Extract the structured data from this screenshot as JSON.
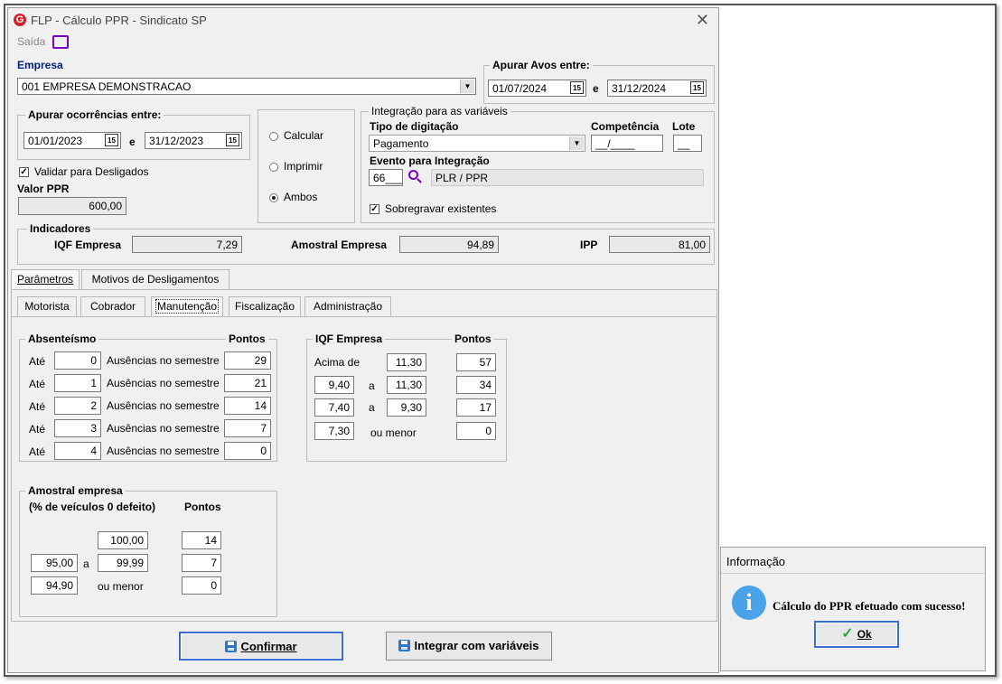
{
  "window": {
    "title": "FLP - Cálculo PPR - Sindicato SP",
    "close_glyph": "✕"
  },
  "menu": {
    "saida": "Saída"
  },
  "empresa": {
    "label": "Empresa",
    "value": "001 EMPRESA DEMONSTRACAO"
  },
  "apurar_avos": {
    "label": "Apurar Avos entre:",
    "from": "01/07/2024",
    "sep": "e",
    "to": "31/12/2024"
  },
  "apurar_ocorrencias": {
    "label": "Apurar ocorrências entre:",
    "from": "01/01/2023",
    "sep": "e",
    "to": "31/12/2023"
  },
  "mode": {
    "options": [
      "Calcular",
      "Imprimir",
      "Ambos"
    ],
    "selected": "Ambos"
  },
  "integracao": {
    "label": "Integração para as variáveis",
    "tipo_label": "Tipo de digitação",
    "tipo_value": "Pagamento",
    "competencia_label": "Competência",
    "competencia_value": "__/____",
    "lote_label": "Lote",
    "lote_value": "__",
    "evento_label": "Evento para Integração",
    "evento_code": "66___",
    "evento_desc": "PLR / PPR",
    "sobregravar_label": "Sobregravar existentes",
    "sobregravar_checked": true
  },
  "validar": {
    "label": "Validar para Desligados",
    "checked": true
  },
  "valor_ppr": {
    "label": "Valor PPR",
    "value": "600,00"
  },
  "indicadores": {
    "label": "Indicadores",
    "iqf_label": "IQF Empresa",
    "iqf_value": "7,29",
    "amostral_label": "Amostral Empresa",
    "amostral_value": "94,89",
    "ipp_label": "IPP",
    "ipp_value": "81,00"
  },
  "tabs": {
    "parametros": "Parâmetros",
    "motivos": "Motivos de Desligamentos"
  },
  "subtabs": {
    "motorista": "Motorista",
    "cobrador": "Cobrador",
    "manutencao": "Manutenção",
    "fiscalizacao": "Fiscalização",
    "administracao": "Administração"
  },
  "absenteismo": {
    "label": "Absenteísmo",
    "pontos_label": "Pontos",
    "rows": [
      {
        "ate": "Até",
        "value": "0",
        "text": "Ausências no semestre",
        "pontos": "29"
      },
      {
        "ate": "Até",
        "value": "1",
        "text": "Ausências no semestre",
        "pontos": "21"
      },
      {
        "ate": "Até",
        "value": "2",
        "text": "Ausências no semestre",
        "pontos": "14"
      },
      {
        "ate": "Até",
        "value": "3",
        "text": "Ausências no semestre",
        "pontos": "7"
      },
      {
        "ate": "Até",
        "value": "4",
        "text": "Ausências no semestre",
        "pontos": "0"
      }
    ]
  },
  "iqf_table": {
    "label": "IQF Empresa",
    "pontos_label": "Pontos",
    "acima_label": "Acima de",
    "acima_value": "11,30",
    "acima_pontos": "57",
    "r2_from": "9,40",
    "r2_sep": "a",
    "r2_to": "11,30",
    "r2_pontos": "34",
    "r3_from": "7,40",
    "r3_sep": "a",
    "r3_to": "9,30",
    "r3_pontos": "17",
    "r4_from": "7,30",
    "r4_text": "ou menor",
    "r4_pontos": "0"
  },
  "amostral_table": {
    "label": "Amostral empresa",
    "sub_label": "(% de veículos 0 defeito)",
    "pontos_label": "Pontos",
    "r1_value": "100,00",
    "r1_pontos": "14",
    "r2_from": "95,00",
    "r2_sep": "a",
    "r2_to": "99,99",
    "r2_pontos": "7",
    "r3_from": "94,90",
    "r3_text": "ou menor",
    "r3_pontos": "0"
  },
  "buttons": {
    "confirmar": "Confirmar",
    "integrar": "Integrar com variáveis"
  },
  "dialog": {
    "title": "Informação",
    "message": "Cálculo do PPR efetuado com sucesso!",
    "ok": "Ok"
  },
  "colors": {
    "accent": "#7a00c8",
    "focus": "#3a6fd0",
    "info": "#4aa3e8",
    "ok_check": "#2fa63a"
  }
}
